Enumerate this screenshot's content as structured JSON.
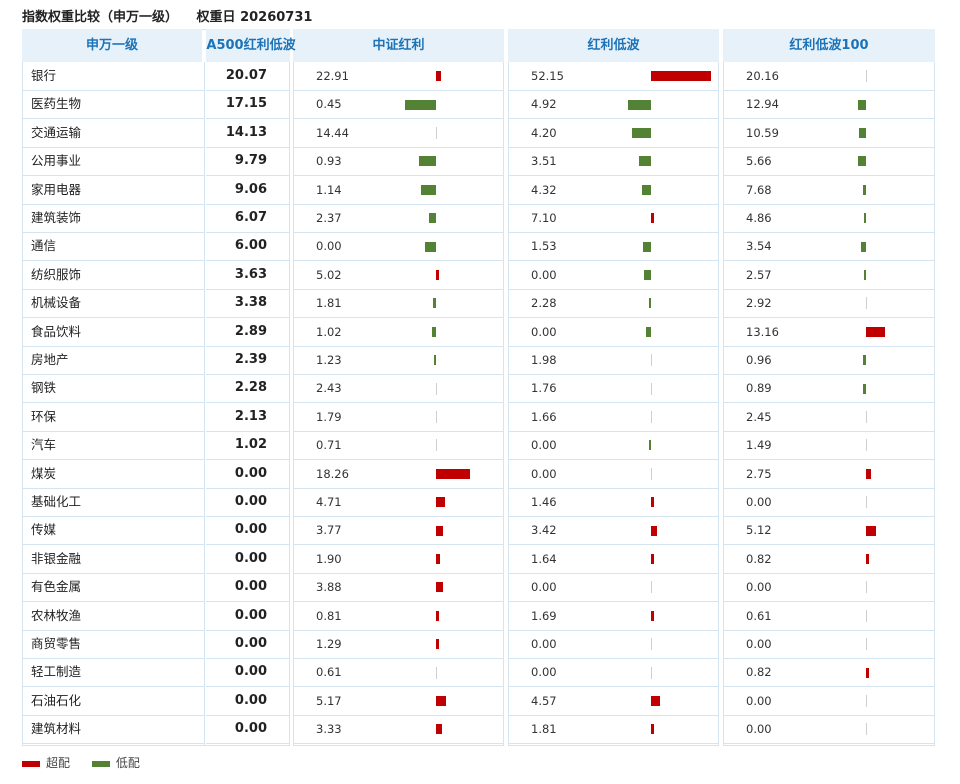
{
  "title": "指数权重比较（申万一级）",
  "weight_date_label": "权重日 20260731",
  "columns": {
    "industry": "申万一级",
    "a500": "A500红利低波",
    "zzhl": "中证红利",
    "hldb": "红利低波",
    "hldb100": "红利低波100"
  },
  "legend": {
    "over": "超配",
    "under": "低配"
  },
  "colors": {
    "over": "#c00000",
    "under": "#548235",
    "header_bg": "#e7f1fa",
    "header_text": "#1c73b8",
    "grid": "#d4e4f1"
  },
  "chart_data": {
    "type": "table",
    "title": "指数权重比较（申万一级）",
    "subtitle": "权重日 20260731",
    "benchmark": "A500红利低波",
    "series": [
      {
        "name": "中证红利",
        "values": [
          22.91,
          0.45,
          14.44,
          0.93,
          1.14,
          2.37,
          0.0,
          5.02,
          1.81,
          1.02,
          1.23,
          2.43,
          1.79,
          0.71,
          18.26,
          4.71,
          3.77,
          1.9,
          3.88,
          0.81,
          1.29,
          0.61,
          5.17,
          3.33
        ]
      },
      {
        "name": "红利低波",
        "values": [
          52.15,
          4.92,
          4.2,
          3.51,
          4.32,
          7.1,
          1.53,
          0.0,
          2.28,
          0.0,
          1.98,
          1.76,
          1.66,
          0.0,
          0.0,
          1.46,
          3.42,
          1.64,
          0.0,
          1.69,
          0.0,
          0.0,
          4.57,
          1.81
        ]
      },
      {
        "name": "红利低波100",
        "values": [
          20.16,
          12.94,
          10.59,
          5.66,
          7.68,
          4.86,
          3.54,
          2.57,
          2.92,
          13.16,
          0.96,
          0.89,
          2.45,
          1.49,
          2.75,
          0.0,
          5.12,
          0.82,
          0.0,
          0.61,
          0.0,
          0.82,
          0.0,
          0.0
        ]
      }
    ],
    "rows": [
      {
        "industry": "银行",
        "a500": "20.07",
        "zzhl": "22.91",
        "hldb": "52.15",
        "hldb100": "20.16"
      },
      {
        "industry": "医药生物",
        "a500": "17.15",
        "zzhl": "0.45",
        "hldb": "4.92",
        "hldb100": "12.94"
      },
      {
        "industry": "交通运输",
        "a500": "14.13",
        "zzhl": "14.44",
        "hldb": "4.20",
        "hldb100": "10.59"
      },
      {
        "industry": "公用事业",
        "a500": "9.79",
        "zzhl": "0.93",
        "hldb": "3.51",
        "hldb100": "5.66"
      },
      {
        "industry": "家用电器",
        "a500": "9.06",
        "zzhl": "1.14",
        "hldb": "4.32",
        "hldb100": "7.68"
      },
      {
        "industry": "建筑装饰",
        "a500": "6.07",
        "zzhl": "2.37",
        "hldb": "7.10",
        "hldb100": "4.86"
      },
      {
        "industry": "通信",
        "a500": "6.00",
        "zzhl": "0.00",
        "hldb": "1.53",
        "hldb100": "3.54"
      },
      {
        "industry": "纺织服饰",
        "a500": "3.63",
        "zzhl": "5.02",
        "hldb": "0.00",
        "hldb100": "2.57"
      },
      {
        "industry": "机械设备",
        "a500": "3.38",
        "zzhl": "1.81",
        "hldb": "2.28",
        "hldb100": "2.92"
      },
      {
        "industry": "食品饮料",
        "a500": "2.89",
        "zzhl": "1.02",
        "hldb": "0.00",
        "hldb100": "13.16"
      },
      {
        "industry": "房地产",
        "a500": "2.39",
        "zzhl": "1.23",
        "hldb": "1.98",
        "hldb100": "0.96"
      },
      {
        "industry": "钢铁",
        "a500": "2.28",
        "zzhl": "2.43",
        "hldb": "1.76",
        "hldb100": "0.89"
      },
      {
        "industry": "环保",
        "a500": "2.13",
        "zzhl": "1.79",
        "hldb": "1.66",
        "hldb100": "2.45"
      },
      {
        "industry": "汽车",
        "a500": "1.02",
        "zzhl": "0.71",
        "hldb": "0.00",
        "hldb100": "1.49"
      },
      {
        "industry": "煤炭",
        "a500": "0.00",
        "zzhl": "18.26",
        "hldb": "0.00",
        "hldb100": "2.75"
      },
      {
        "industry": "基础化工",
        "a500": "0.00",
        "zzhl": "4.71",
        "hldb": "1.46",
        "hldb100": "0.00"
      },
      {
        "industry": "传媒",
        "a500": "0.00",
        "zzhl": "3.77",
        "hldb": "3.42",
        "hldb100": "5.12"
      },
      {
        "industry": "非银金融",
        "a500": "0.00",
        "zzhl": "1.90",
        "hldb": "1.64",
        "hldb100": "0.82"
      },
      {
        "industry": "有色金属",
        "a500": "0.00",
        "zzhl": "3.88",
        "hldb": "0.00",
        "hldb100": "0.00"
      },
      {
        "industry": "农林牧渔",
        "a500": "0.00",
        "zzhl": "0.81",
        "hldb": "1.69",
        "hldb100": "0.61"
      },
      {
        "industry": "商贸零售",
        "a500": "0.00",
        "zzhl": "1.29",
        "hldb": "0.00",
        "hldb100": "0.00"
      },
      {
        "industry": "轻工制造",
        "a500": "0.00",
        "zzhl": "0.61",
        "hldb": "0.00",
        "hldb100": "0.82"
      },
      {
        "industry": "石油石化",
        "a500": "0.00",
        "zzhl": "5.17",
        "hldb": "4.57",
        "hldb100": "0.00"
      },
      {
        "industry": "建筑材料",
        "a500": "0.00",
        "zzhl": "3.33",
        "hldb": "1.81",
        "hldb100": "0.00"
      }
    ]
  }
}
